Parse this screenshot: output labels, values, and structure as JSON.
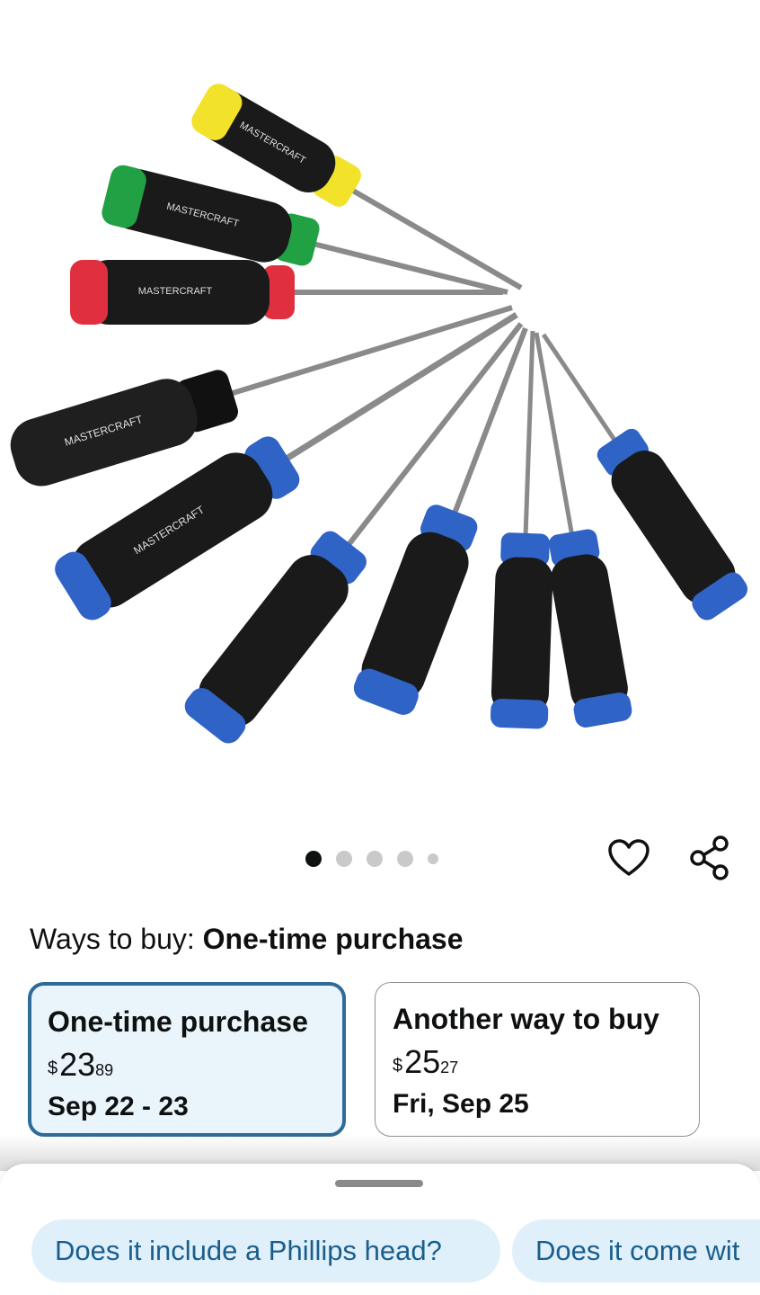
{
  "product": {
    "image_alt": "Mastercraft screwdriver set",
    "brand_imprint": "MASTERCRAFT",
    "carousel": {
      "total": 5,
      "active_index": 0
    }
  },
  "ways_to_buy": {
    "label": "Ways to buy:",
    "selected": "One-time purchase"
  },
  "options": [
    {
      "title": "One-time purchase",
      "currency": "$",
      "price_whole": "23",
      "price_fraction": "89",
      "delivery": "Sep 22 - 23",
      "selected": true
    },
    {
      "title": "Another way to buy",
      "currency": "$",
      "price_whole": "25",
      "price_fraction": "27",
      "delivery": "Fri, Sep 25",
      "selected": false
    }
  ],
  "suggestions": [
    "Does it include a Phillips head?",
    "Does it come wit"
  ],
  "colors": {
    "selected_border": "#2d6b99",
    "selected_bg": "#eaf4fb",
    "chip_bg": "#dff0fb",
    "chip_text": "#1b5e8c",
    "handle_blue": "#2f63c6",
    "handle_yellow": "#f2e22a",
    "handle_green": "#22a044",
    "handle_red": "#e0303f"
  },
  "icons": [
    "heart-icon",
    "share-icon"
  ]
}
